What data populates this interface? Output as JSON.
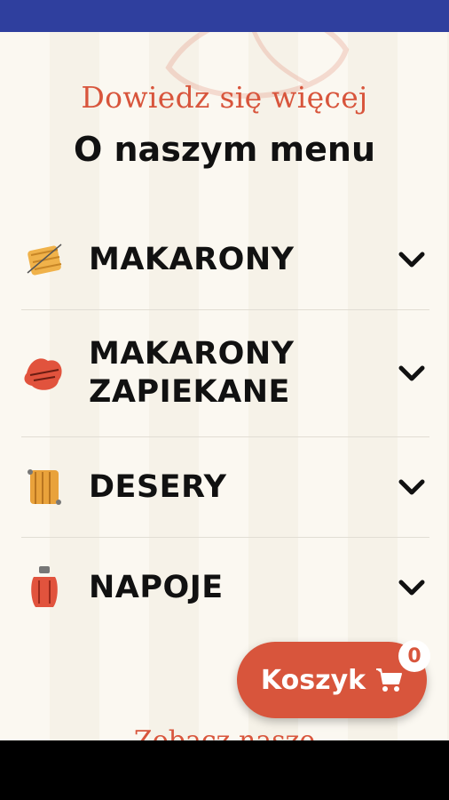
{
  "header": {
    "eyebrow": "Dowiedz się więcej",
    "title": "O naszym menu"
  },
  "menu": {
    "items": [
      {
        "label": "MAKARONY",
        "icon": "pasta-icon"
      },
      {
        "label": "MAKARONY\nZAPIEKANE",
        "icon": "baked-pasta-icon"
      },
      {
        "label": "DESERY",
        "icon": "dessert-icon"
      },
      {
        "label": "NAPOJE",
        "icon": "drink-icon"
      }
    ]
  },
  "footer": {
    "peek_text": "Zobacz nasze"
  },
  "cart": {
    "label": "Koszyk",
    "count": "0"
  },
  "colors": {
    "accent": "#d8553c",
    "status_bar": "#2f3f9e"
  }
}
